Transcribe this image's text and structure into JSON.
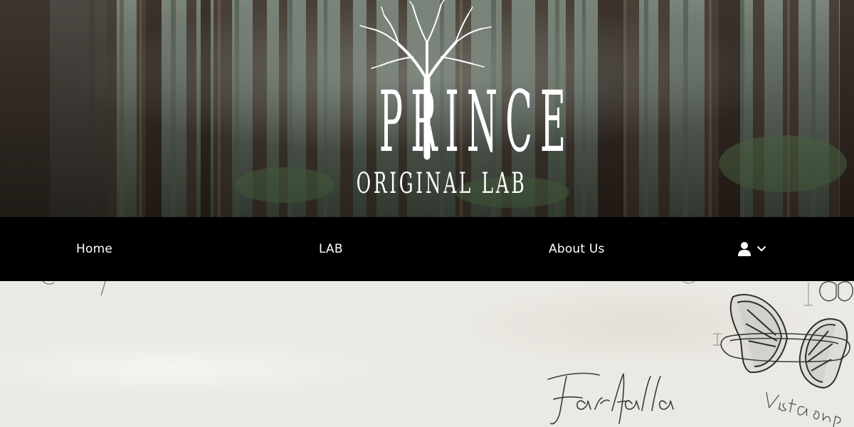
{
  "brand": {
    "logo_word": "PRINCE",
    "logo_sub": "ORIGINAL LAB"
  },
  "nav": {
    "items": [
      {
        "label": "Home"
      },
      {
        "label": "LAB"
      },
      {
        "label": "About Us"
      }
    ],
    "account_icon": "user-icon",
    "account_menu_icon": "chevron-down-icon"
  },
  "sketch": {
    "handwriting_1": "Farfallao",
    "handwriting_2": "Vista superiore"
  },
  "colors": {
    "nav_background": "#000000",
    "nav_text": "#ffffff",
    "paper": "#ebe9e3"
  }
}
